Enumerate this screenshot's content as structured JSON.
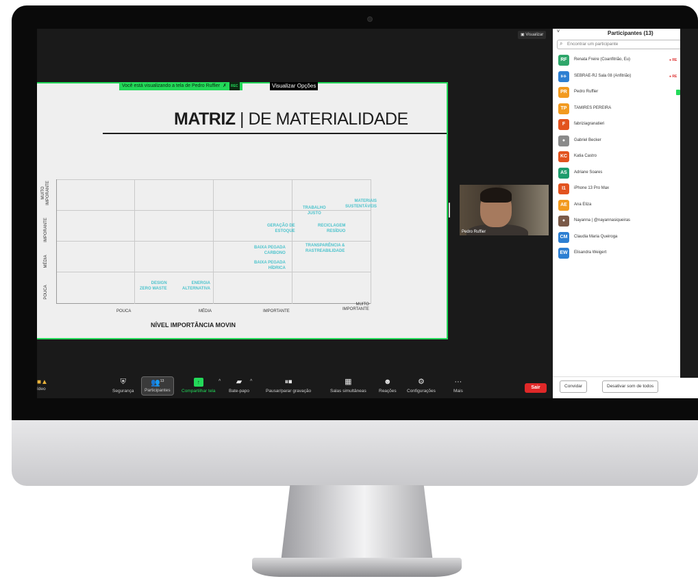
{
  "zoom": {
    "view_button": "Visualizar",
    "share_banner": "Você está visualizando a tela de Pedro Ruffier",
    "rec_badge": "REC",
    "view_options": "Visualizar Opções",
    "speaker_name": "Pedro Ruffier"
  },
  "slide": {
    "title_bold": "MATRIZ",
    "title_rest": "| DE MATERIALIDADE",
    "y_labels": [
      "MUITO IMPORANTE",
      "IMPORANTE",
      "MÉDIA",
      "POUCA"
    ],
    "x_labels": [
      "POUCA",
      "MÉDIA",
      "IMPORTANTE",
      "MUITO IMPORTANTE"
    ],
    "x_title": "NÍVEL IMPORTÂNCIA MOVIN",
    "items": [
      {
        "line1": "MATERIAIS",
        "line2": "SUSTENTÁVEIS"
      },
      {
        "line1": "TRABALHO",
        "line2": "JUSTO"
      },
      {
        "line1": "GERAÇÃO DE",
        "line2": "ESTOQUE"
      },
      {
        "line1": "RECICLAGEM",
        "line2": "RESÍDUO"
      },
      {
        "line1": "BAIXA PEGADA",
        "line2": "CARBONO"
      },
      {
        "line1": "TRANSPARÊNCIA &",
        "line2": "RASTREABILIDADE"
      },
      {
        "line1": "BAIXA PEGADA",
        "line2": "HÍDRICA"
      },
      {
        "line1": "DESIGN",
        "line2": "ZERO WASTE"
      },
      {
        "line1": "ENERGIA",
        "line2": "ALTERNATIVA"
      }
    ]
  },
  "toolbar": {
    "video": "ídeo",
    "security": "Segurança",
    "participants": "Participantes",
    "participants_count": "13",
    "share": "Compartilhar tela",
    "chat": "Bate-papo",
    "record": "Pausar/parar gravação",
    "breakout": "Salas simultâneas",
    "reactions": "Reações",
    "settings": "Configurações",
    "more": "Mais",
    "leave": "Sair"
  },
  "panel": {
    "title": "Participantes (13)",
    "search_placeholder": "Encontrar um participante",
    "invite": "Convidar",
    "mute_all": "Desativar som de todos",
    "participants": [
      {
        "initials": "RF",
        "name": "Renata Freire (Coanfitrião, Eu)",
        "color": "#2ea66a",
        "rec": "● RE"
      },
      {
        "initials": "",
        "name": "SEBRAE-RJ Sala 08 (Anfitrião)",
        "color": "#2d7fd2",
        "rec": "● RE"
      },
      {
        "initials": "PR",
        "name": "Pedro Ruffier",
        "color": "#f29a1f",
        "rec": ""
      },
      {
        "initials": "TP",
        "name": "TAMIRES PEREIRA",
        "color": "#f29a1f",
        "rec": ""
      },
      {
        "initials": "F",
        "name": "fabriziagranatieri",
        "color": "#e2531f",
        "rec": ""
      },
      {
        "initials": "",
        "name": "Gabriel Becker",
        "color": "#8a8a8a",
        "rec": ""
      },
      {
        "initials": "KC",
        "name": "Katia Castro",
        "color": "#e2531f",
        "rec": ""
      },
      {
        "initials": "AS",
        "name": "Adriane Soares",
        "color": "#1e9c6c",
        "rec": ""
      },
      {
        "initials": "I1",
        "name": "iPhone 13 Pro Max",
        "color": "#e2531f",
        "rec": ""
      },
      {
        "initials": "AE",
        "name": "Ana Eliza",
        "color": "#f29a1f",
        "rec": ""
      },
      {
        "initials": "",
        "name": "Nayanna | @nayannasiqueiras",
        "color": "#7a5a48",
        "rec": ""
      },
      {
        "initials": "CM",
        "name": "Claudia Maria Queiroga",
        "color": "#2d7fd2",
        "rec": ""
      },
      {
        "initials": "EW",
        "name": "Elisandra Weigert",
        "color": "#2d7fd2",
        "rec": ""
      }
    ]
  }
}
